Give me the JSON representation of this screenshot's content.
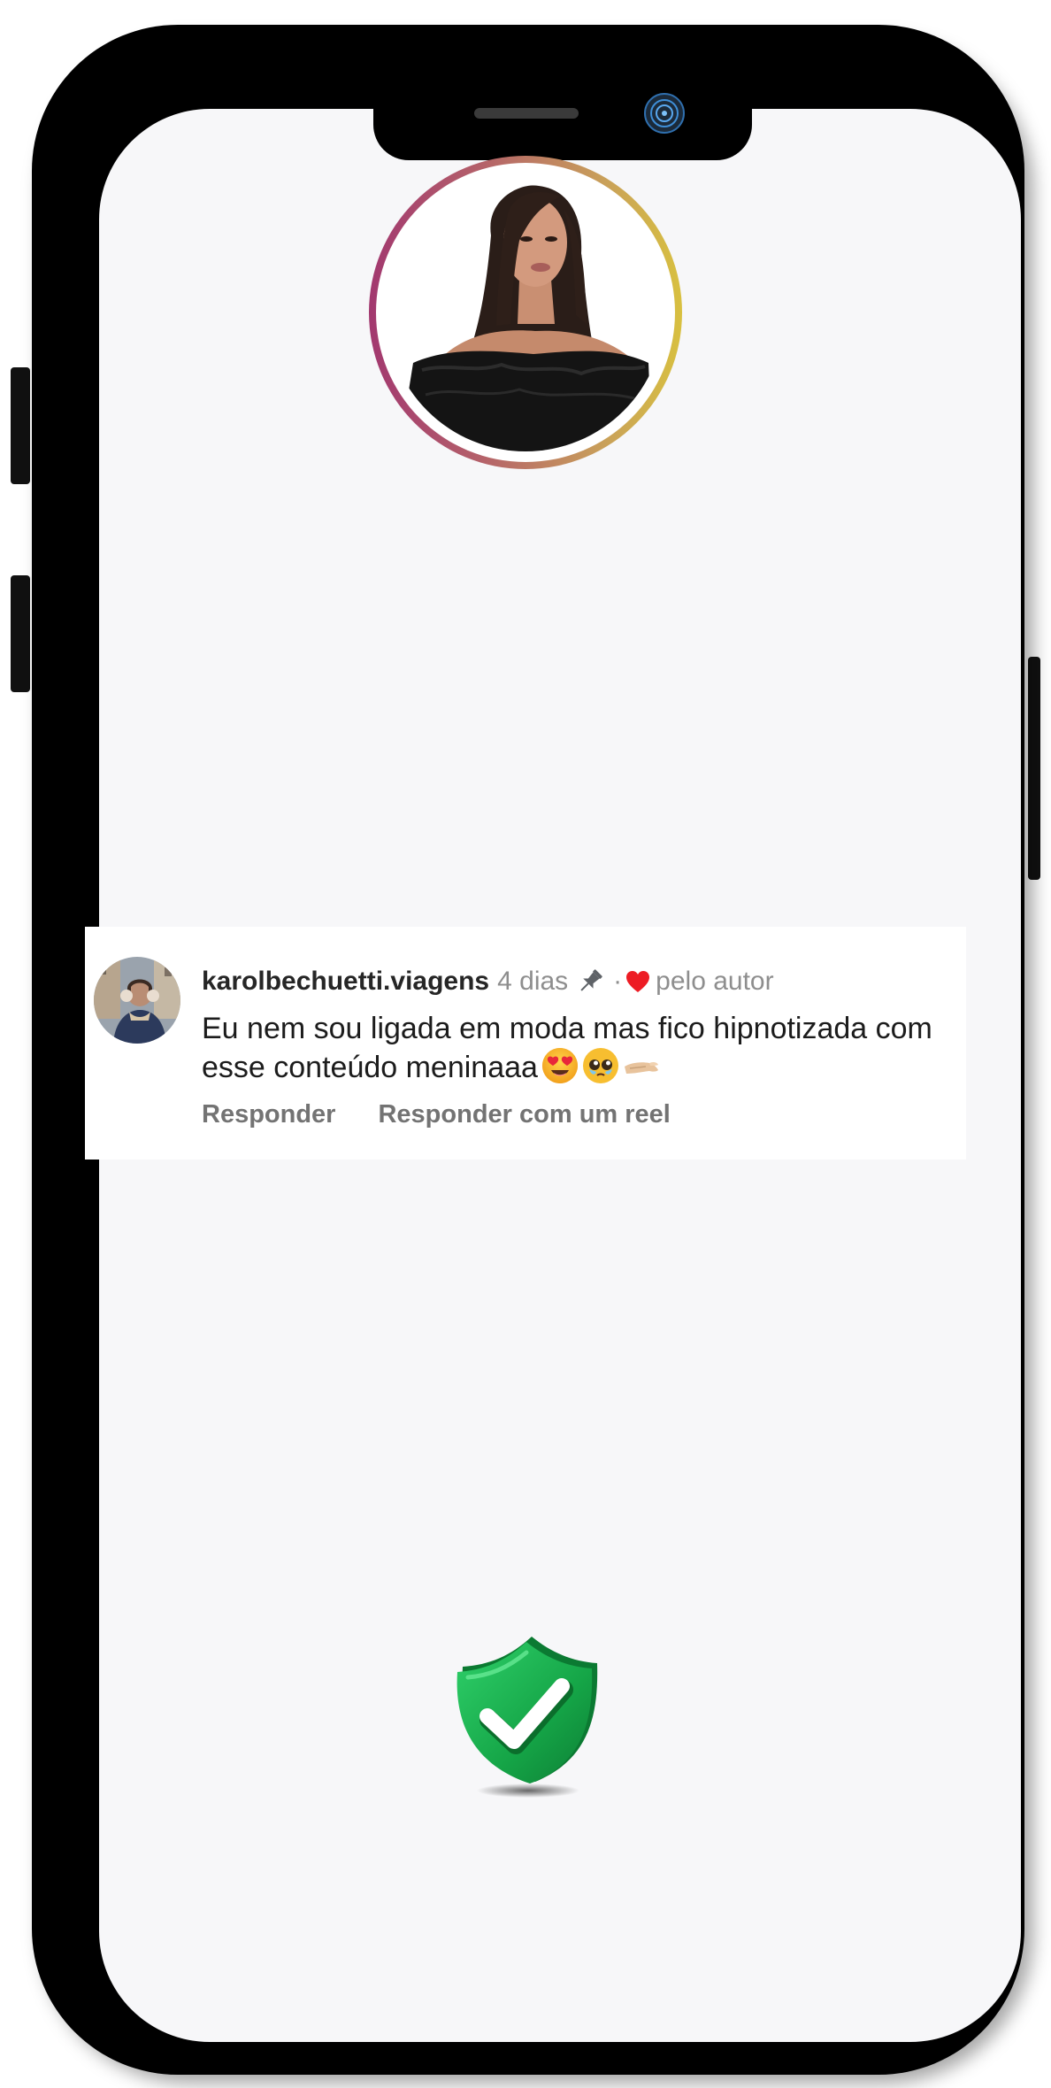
{
  "profile": {
    "avatar_label": "profile-photo"
  },
  "comment": {
    "username": "karolbechuetti.viagens",
    "time": "4 dias",
    "separator": "·",
    "liked_by": "pelo autor",
    "text": "Eu nem sou ligada em moda mas fico hipnotizada com esse conteúdo meninaaa",
    "emojis": [
      "smiling-face-with-heart-eyes",
      "pleading-face",
      "pinched-fingers"
    ],
    "actions": {
      "reply": "Responder",
      "reply_reel": "Responder com um reel"
    }
  },
  "colors": {
    "ring_start": "#a2386f",
    "ring_end": "#d8c040",
    "heart": "#ed1c24",
    "shield": "#18a84a"
  }
}
